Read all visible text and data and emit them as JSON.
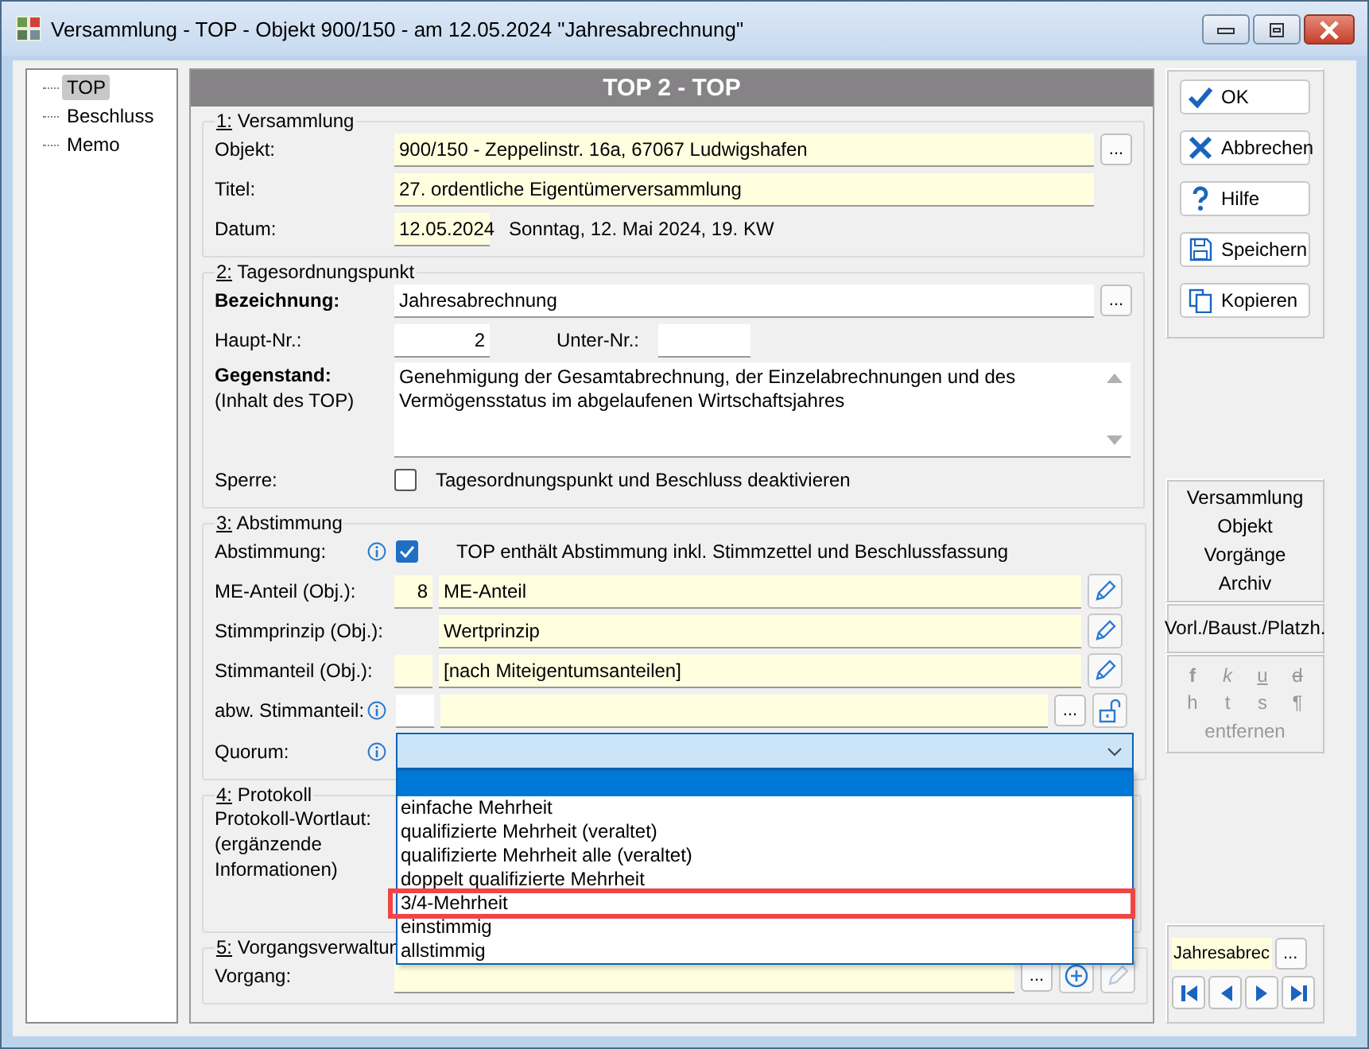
{
  "window": {
    "title": "Versammlung - TOP - Objekt 900/150 - am 12.05.2024 \"Jahresabrechnung\""
  },
  "tree": [
    {
      "label": "TOP",
      "selected": true
    },
    {
      "label": "Beschluss",
      "selected": false
    },
    {
      "label": "Memo",
      "selected": false
    }
  ],
  "header": "TOP 2 - TOP",
  "section1": {
    "legend": "1: Versammlung",
    "objekt_label": "Objekt:",
    "objekt": "900/150 - Zeppelinstr. 16a, 67067 Ludwigshafen",
    "objekt_button": "...",
    "titel_label": "Titel:",
    "titel": "27. ordentliche Eigentümerversammlung",
    "datum_label": "Datum:",
    "datum": "12.05.2024",
    "datum_text": "Sonntag,  12. Mai 2024,  19. KW"
  },
  "section2": {
    "legend": "2: Tagesordnungspunkt",
    "bez_label": "Bezeichnung:",
    "bez": "Jahresabrechnung",
    "bez_button": "...",
    "haupt_label": "Haupt-Nr.:",
    "haupt": "2",
    "unter_label": "Unter-Nr.:",
    "gegenstand_label": "Gegenstand:",
    "gegenstand_sub": "(Inhalt des TOP)",
    "gegenstand": "Genehmigung der Gesamtabrechnung, der Einzelabrechnungen und des Vermögensstatus im abgelaufenen Wirtschaftsjahres",
    "sperre_label": "Sperre:",
    "sperre_text": "Tagesordnungspunkt und Beschluss deaktivieren",
    "sperre_checked": false
  },
  "section3": {
    "legend": "3: Abstimmung",
    "abst_label": "Abstimmung:",
    "abst_checked": true,
    "abst_text": "TOP enthält Abstimmung inkl. Stimmzettel und Beschlussfassung",
    "me_label": "ME-Anteil (Obj.):",
    "me_value": "8",
    "me_text": "ME-Anteil",
    "prinzip_label": "Stimmprinzip (Obj.):",
    "prinzip_text": "Wertprinzip",
    "anteil_label": "Stimmanteil (Obj.):",
    "anteil_text": "[nach Miteigentumsanteilen]",
    "abw_label": "abw. Stimmanteil:",
    "abw_button": "...",
    "quorum_label": "Quorum:",
    "quorum_open": true,
    "quorum_blank_selected": true,
    "quorum_options": [
      {
        "label": "einfache Mehrheit",
        "selected": false,
        "highlighted": false
      },
      {
        "label": "qualifizierte Mehrheit (veraltet)",
        "selected": false,
        "highlighted": false
      },
      {
        "label": "qualifizierte Mehrheit alle (veraltet)",
        "selected": false,
        "highlighted": false
      },
      {
        "label": "doppelt qualifizierte Mehrheit",
        "selected": false,
        "highlighted": false
      },
      {
        "label": "3/4-Mehrheit",
        "selected": false,
        "highlighted": true
      },
      {
        "label": "einstimmig",
        "selected": false,
        "highlighted": false
      },
      {
        "label": "allstimmig",
        "selected": false,
        "highlighted": false
      }
    ]
  },
  "section4": {
    "legend": "4: Protokoll",
    "wortlaut_lines": [
      "Protokoll-Wortlaut:",
      "(ergänzende",
      "Informationen)"
    ]
  },
  "section5": {
    "legend": "5: Vorgangsverwaltun",
    "vorgang_label": "Vorgang:",
    "vorgang_button": "..."
  },
  "actions": [
    {
      "label": "OK",
      "kind": "ok"
    },
    {
      "label": "Abbrechen",
      "kind": "cancel"
    },
    {
      "label": "Hilfe",
      "kind": "help"
    },
    {
      "label": "Speichern",
      "kind": "save"
    },
    {
      "label": "Kopieren",
      "kind": "copy"
    }
  ],
  "links": [
    "Versammlung",
    "Objekt",
    "Vorgänge",
    "Archiv"
  ],
  "placeholder_link": "Vorl./Baust./Platzh.",
  "format": {
    "disabled": true,
    "buttons": [
      {
        "label": "f",
        "kind": "bold"
      },
      {
        "label": "k",
        "kind": "italic"
      },
      {
        "label": "u",
        "kind": "underline"
      },
      {
        "label": "d",
        "kind": "strike"
      },
      {
        "label": "h",
        "kind": "plain"
      },
      {
        "label": "t",
        "kind": "plain"
      },
      {
        "label": "s",
        "kind": "plain"
      },
      {
        "label": "¶",
        "kind": "plain"
      }
    ],
    "remove": "entfernen"
  },
  "record": {
    "value": "Jahresabrec",
    "button": "..."
  }
}
